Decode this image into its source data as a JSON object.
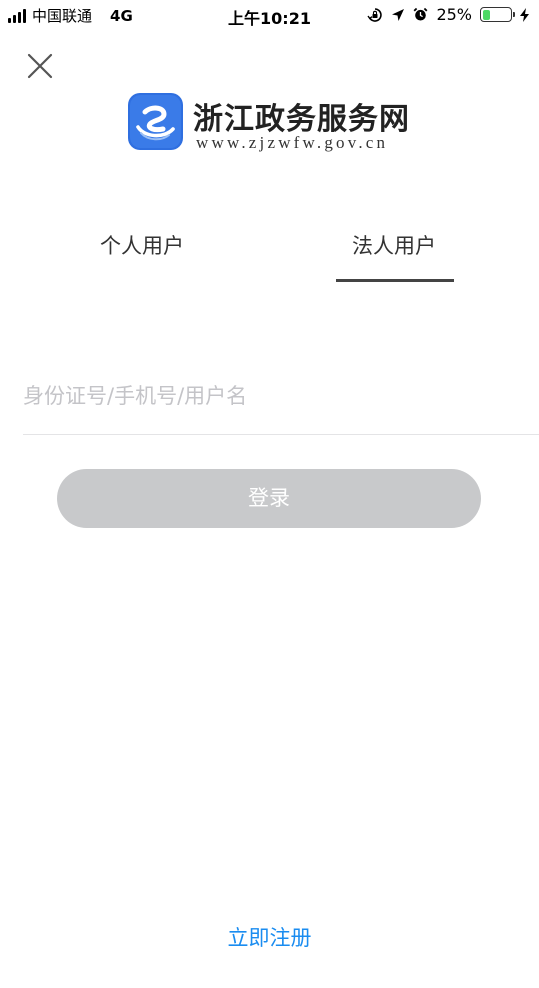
{
  "status_bar": {
    "carrier": "中国联通",
    "network": "4G",
    "time": "上午10:21",
    "battery": "25%",
    "battery_level": 0.25,
    "battery_color": "#4cd964",
    "icons": [
      "signal-icon",
      "rotation-lock-icon",
      "location-arrow-icon",
      "alarm-icon",
      "battery-icon",
      "charging-icon"
    ]
  },
  "header": {
    "close_icon": "close-icon",
    "logo_icon": "zjzwfw-logo-icon",
    "title": "浙江政务服务网",
    "url": "www.zjzwfw.gov.cn",
    "brand_color": "#2f6fe0"
  },
  "tabs": [
    {
      "label": "个人用户",
      "active": false
    },
    {
      "label": "法人用户",
      "active": true
    }
  ],
  "form": {
    "account_placeholder": "身份证号/手机号/用户名",
    "account_value": "",
    "login_label": "登录",
    "login_disabled_color": "#c8c9cb"
  },
  "footer": {
    "register_label": "立即注册",
    "link_color": "#1a8cf0"
  }
}
